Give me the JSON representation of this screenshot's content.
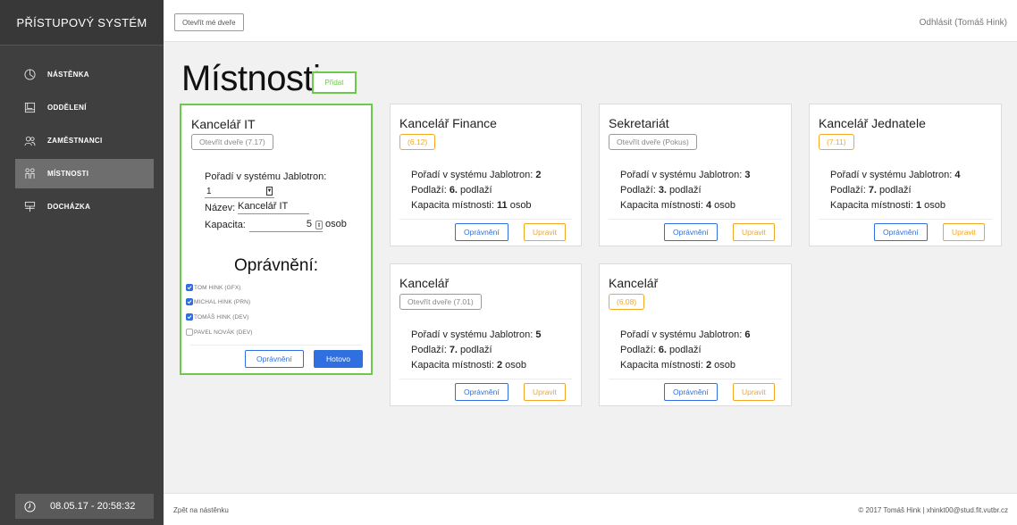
{
  "sidebar": {
    "brand": "PŘÍSTUPOVÝ SYSTÉM",
    "items": [
      {
        "label": "NÁSTĚNKA",
        "icon": "dashboard-icon"
      },
      {
        "label": "ODDĚLENÍ",
        "icon": "book-icon"
      },
      {
        "label": "ZAMĚSTNANCI",
        "icon": "people-icon"
      },
      {
        "label": "MÍSTNOSTI",
        "icon": "rooms-icon",
        "active": true
      },
      {
        "label": "DOCHÁZKA",
        "icon": "attendance-icon"
      }
    ],
    "clock": "08.05.17 - 20:58:32"
  },
  "topbar": {
    "open_my_door": "Otevřít mé dveře",
    "logout": "Odhlásit (Tomáš Hink)"
  },
  "page": {
    "title": "Místnosti",
    "add_label": "Přidat"
  },
  "edit_card": {
    "title": "Kancelář IT",
    "door_button": "Otevřít dveře (7.17)",
    "order_label": "Pořadí v systému Jablotron:",
    "order_value": "1",
    "name_label": "Název:",
    "name_value": "Kancelář IT",
    "capacity_label": "Kapacita:",
    "capacity_value": "5",
    "capacity_unit": "osob",
    "permissions_title": "Oprávnění:",
    "permissions": [
      {
        "label": "TOM HINK (GFX)",
        "checked": true
      },
      {
        "label": "MICHAL HINK (PRN)",
        "checked": true
      },
      {
        "label": "TOMÁŠ HINK (DEV)",
        "checked": true
      },
      {
        "label": "PAVEL NOVÁK (DEV)",
        "checked": false
      }
    ],
    "permissions_button": "Oprávnění",
    "done_button": "Hotovo"
  },
  "labels": {
    "order": "Pořadí v systému Jablotron: ",
    "floor": "Podlaží: ",
    "floor_suffix": " podlaží",
    "capacity": "Kapacita místnosti: ",
    "capacity_suffix": " osob",
    "permissions_button": "Oprávnění",
    "edit_button": "Upravit"
  },
  "rooms": [
    {
      "title": "Kancelář Finance",
      "door": "(6.12)",
      "order": "2",
      "floor": "6.",
      "capacity": "11"
    },
    {
      "title": "Sekretariát",
      "door": "Otevřít dveře (Pokus)",
      "order": "3",
      "floor": "3.",
      "capacity": "4"
    },
    {
      "title": "Kancelář Jednatele",
      "door": "(7.11)",
      "order": "4",
      "floor": "7.",
      "capacity": "1"
    },
    {
      "title": "Kancelář",
      "door": "Otevřít dveře (7.01)",
      "order": "5",
      "floor": "7.",
      "capacity": "2"
    },
    {
      "title": "Kancelář",
      "door": "(6.08)",
      "order": "6",
      "floor": "6.",
      "capacity": "2"
    }
  ],
  "footer": {
    "back": "Zpět na nástěnku",
    "copyright": "© 2017 Tomáš Hink | xhinkt00@stud.fit.vutbr.cz"
  }
}
